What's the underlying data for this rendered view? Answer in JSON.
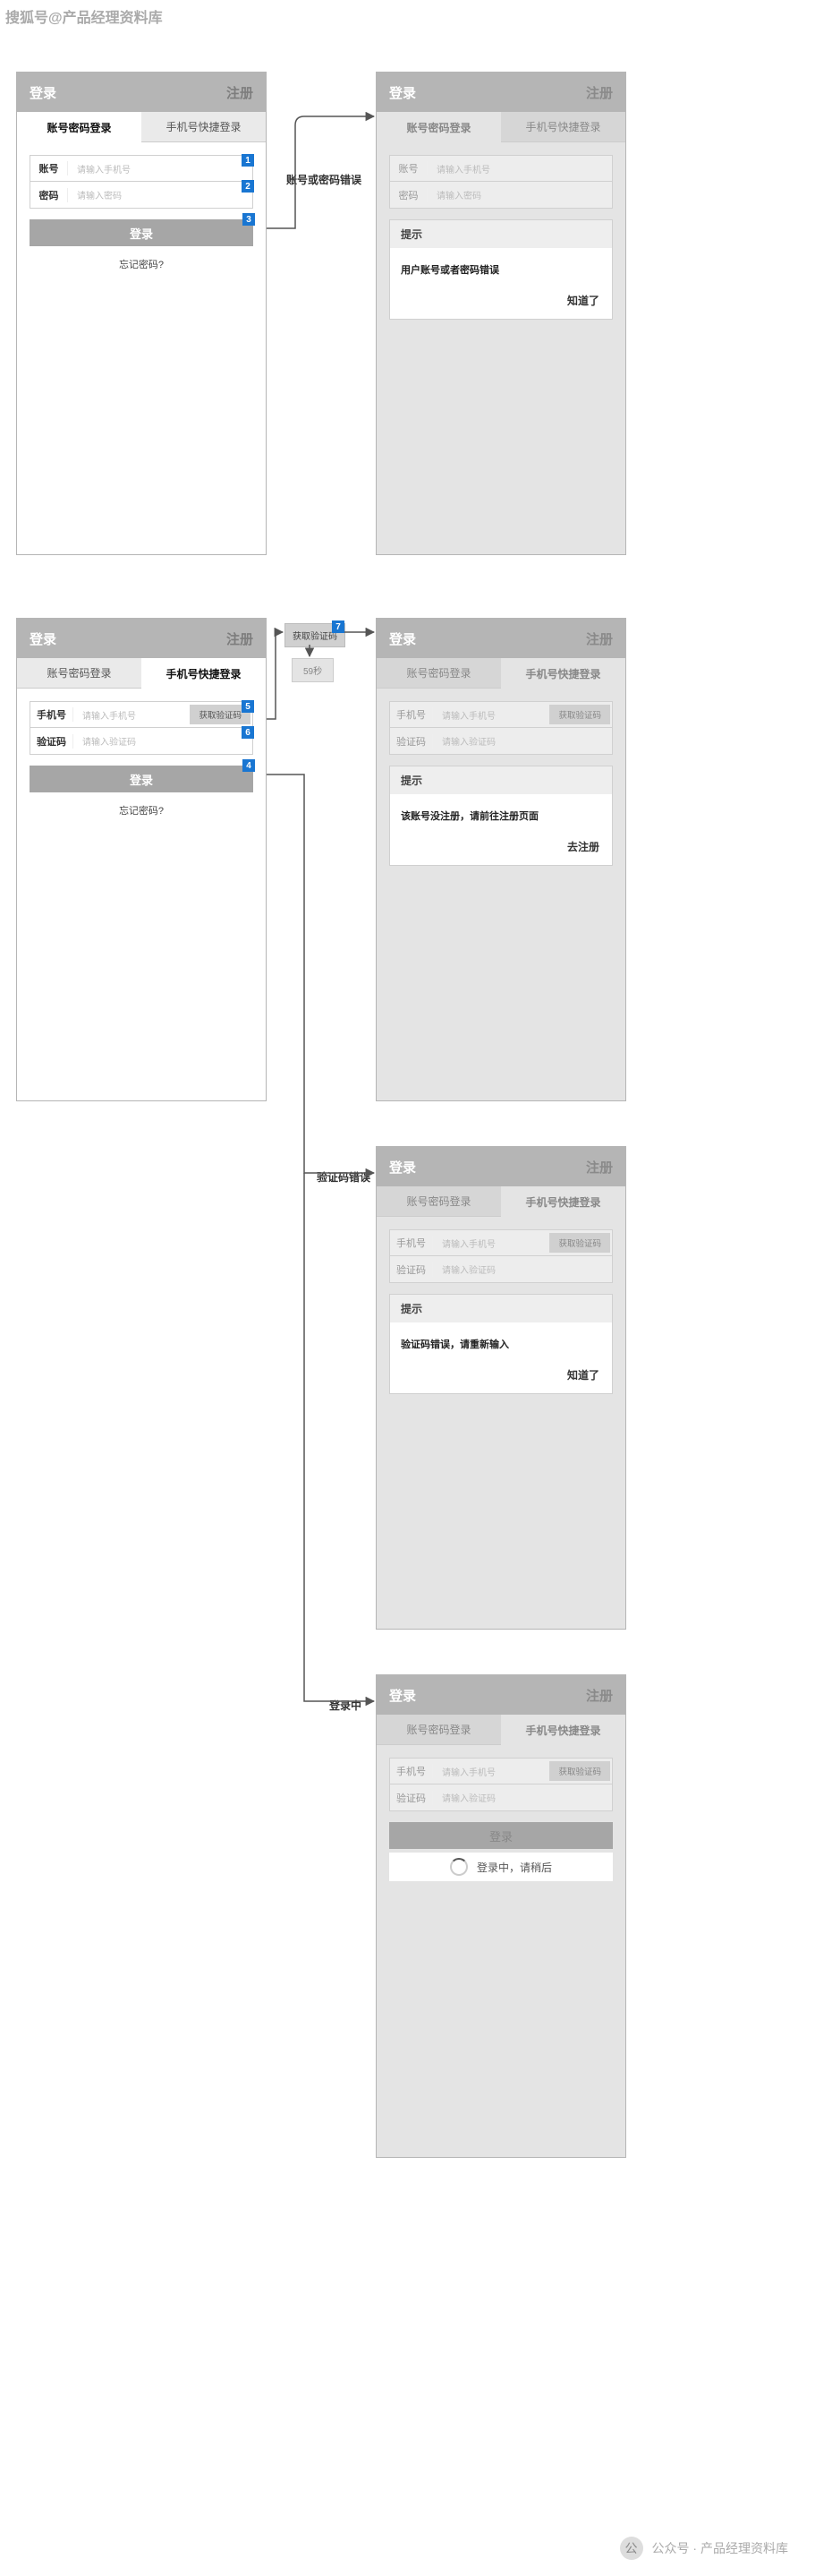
{
  "watermark_top": "搜狐号@产品经理资料库",
  "watermark_bottom": {
    "icon": "公",
    "text": "公众号 · 产品经理资料库"
  },
  "common": {
    "login": "登录",
    "register": "注册",
    "tab_password": "账号密码登录",
    "tab_sms": "手机号快捷登录",
    "forgot": "忘记密码?",
    "tip_title": "提示",
    "btn_login": "登录",
    "got_it": "知道了"
  },
  "fields": {
    "account": "账号",
    "password": "密码",
    "phone": "手机号",
    "code": "验证码",
    "ph_phone": "请输入手机号",
    "ph_password": "请输入密码",
    "ph_code": "请输入验证码",
    "btn_getcode": "获取验证码"
  },
  "labels": {
    "bad_account": "账号或密码错误",
    "bad_code": "验证码错误",
    "logging_in": "登录中",
    "countdown": "59秒"
  },
  "tips": {
    "bad_account": "用户账号或者密码错误",
    "not_registered": "该账号没注册，请前往注册页面",
    "bad_code": "验证码错误，请重新输入",
    "go_register": "去注册"
  },
  "loading": {
    "text": "登录中，请稍后"
  }
}
